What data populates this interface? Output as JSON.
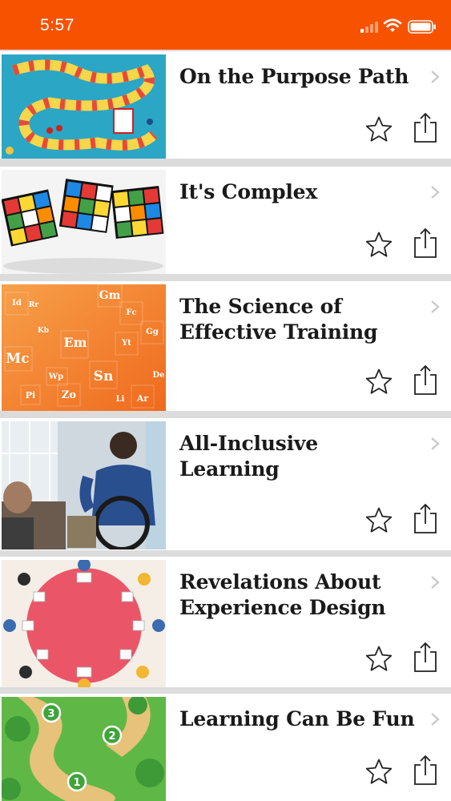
{
  "status_bar": {
    "time": "5:57",
    "background": "#f75200"
  },
  "courses": [
    {
      "title": "On the Purpose Path",
      "thumbnail": "board-game",
      "favorite": false
    },
    {
      "title": "It's Complex",
      "thumbnail": "rubiks-cubes",
      "favorite": false
    },
    {
      "title": "The Science of Effective Training",
      "thumbnail": "periodic-table",
      "favorite": false
    },
    {
      "title": "All-Inclusive Learning",
      "thumbnail": "wheelchair-user",
      "favorite": false
    },
    {
      "title": "Revelations About Experience Design",
      "thumbnail": "round-table",
      "favorite": false
    },
    {
      "title": "Learning Can Be Fun",
      "thumbnail": "game-map",
      "favorite": false
    }
  ],
  "icons": {
    "favorite": "star-outline-icon",
    "share": "share-icon",
    "disclosure": "chevron-right-icon"
  },
  "thumb_labels": {
    "elements": [
      "Gm",
      "Id",
      "Mc",
      "Em",
      "Sn",
      "Zo",
      "Pi",
      "Fc",
      "Gg",
      "Yt",
      "Ar",
      "Wp",
      "Kb",
      "Rr",
      "Li",
      "De"
    ],
    "levels": [
      "3",
      "2",
      "1"
    ]
  }
}
